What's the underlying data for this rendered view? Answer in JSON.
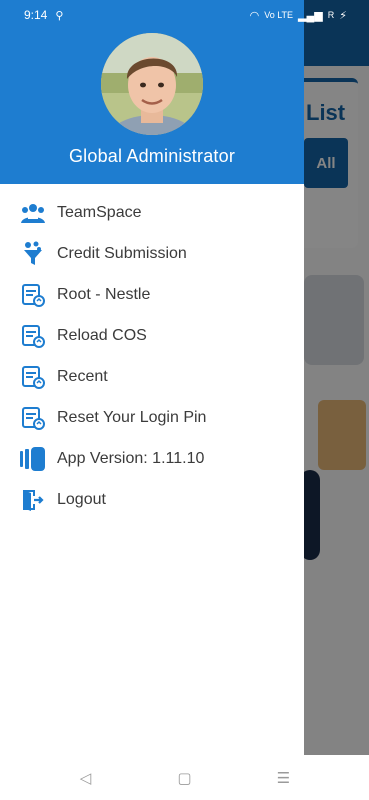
{
  "status_bar": {
    "time": "9:14",
    "signal_text": "Vo LTE",
    "network_text": "R"
  },
  "background_app": {
    "card_title": "List",
    "filter_button": "All"
  },
  "drawer": {
    "user_name": "Global Administrator",
    "items": [
      {
        "label": "TeamSpace",
        "icon": "team-icon"
      },
      {
        "label": "Credit Submission",
        "icon": "funnel-icon"
      },
      {
        "label": "Root - Nestle",
        "icon": "document-refresh-icon"
      },
      {
        "label": "Reload COS",
        "icon": "document-refresh-icon"
      },
      {
        "label": "Recent",
        "icon": "document-refresh-icon"
      },
      {
        "label": "Reset Your Login Pin",
        "icon": "document-refresh-icon"
      },
      {
        "label": "App Version: 1.11.10",
        "icon": "version-icon"
      },
      {
        "label": "Logout",
        "icon": "logout-icon"
      }
    ]
  },
  "nav_bar": {
    "back": "◁",
    "home": "▢",
    "recents": "☰"
  },
  "colors": {
    "header": "#1e7dd0",
    "icon": "#1e7dd0",
    "app_bar": "#1565a8"
  }
}
